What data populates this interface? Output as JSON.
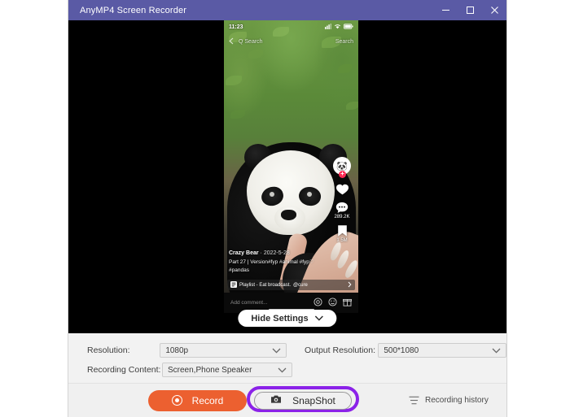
{
  "window": {
    "title": "AnyMP4 Screen Recorder",
    "titlebar_color": "#5a5aa5",
    "controls": {
      "minimize": "minimize-icon",
      "maximize": "maximize-icon",
      "close": "close-icon"
    }
  },
  "phone": {
    "status": {
      "time": "11:23",
      "icons": [
        "signal-icon",
        "wifi-icon",
        "battery-icon"
      ]
    },
    "nav": {
      "back": "back-chevron-icon",
      "title": "Q Search",
      "action": "Search"
    },
    "rail": {
      "avatar": "panda-avatar",
      "follow_badge": "+",
      "like_icon": "heart-icon",
      "like_count": "",
      "comment_icon": "comment-icon",
      "comment_count": "289.2K",
      "bookmark_icon": "bookmark-icon",
      "bookmark_count": "1.5M",
      "share_icon": "share-icon"
    },
    "caption": {
      "author": "Crazy Bear",
      "date": "2022-5-28",
      "description": "Part 27 | Version#fyp #animal #fyp♡ #pandas"
    },
    "playlist": {
      "icon": "playlist-icon",
      "label": "Playlist - Eat broadcast.",
      "handle": "@cure",
      "chevron": "chevron-right-icon"
    },
    "comment_bar": {
      "placeholder": "Add comment...",
      "icons": [
        "at-mention-icon",
        "emoji-icon",
        "gift-icon"
      ]
    }
  },
  "hide_settings": {
    "label": "Hide Settings",
    "chevron": "chevron-down-icon"
  },
  "settings": {
    "resolution": {
      "label": "Resolution:",
      "value": "1080p",
      "chevron": "chevron-down-icon"
    },
    "output_resolution": {
      "label": "Output Resolution:",
      "value": "500*1080",
      "chevron": "chevron-down-icon"
    },
    "recording_content": {
      "label": "Recording Content:",
      "value": "Screen,Phone Speaker",
      "chevron": "chevron-down-icon"
    }
  },
  "actions": {
    "record": {
      "label": "Record",
      "icon": "record-dot-icon",
      "color": "#ec6030"
    },
    "snapshot": {
      "label": "SnapShot",
      "icon": "camera-icon",
      "highlight_color": "#8b22e8"
    },
    "history": {
      "label": "Recording history",
      "icon": "list-icon"
    }
  }
}
